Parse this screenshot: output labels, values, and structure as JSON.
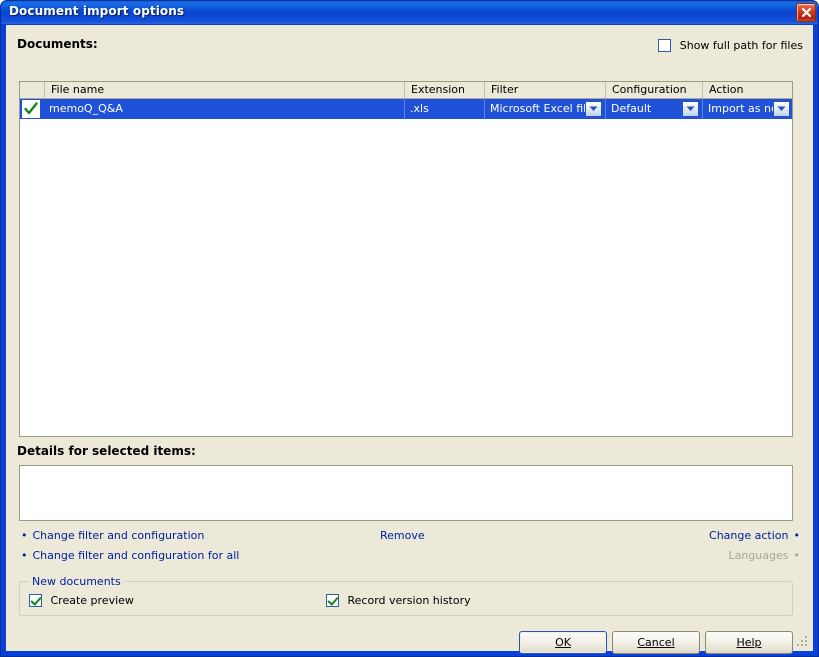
{
  "window": {
    "title": "Document import options",
    "close_icon": "close-icon"
  },
  "documents": {
    "label": "Documents:",
    "show_full_path": {
      "label": "Show full path for files",
      "checked": false
    },
    "columns": [
      "File name",
      "Extension",
      "Filter",
      "Configuration",
      "Action"
    ],
    "rows": [
      {
        "checked": true,
        "file_name": "memoQ_Q&A",
        "extension": ".xls",
        "filter": "Microsoft Excel filter",
        "configuration": "Default",
        "action": "Import as new"
      }
    ]
  },
  "details": {
    "label": "Details for selected items:",
    "text": ""
  },
  "links": {
    "change_filter": "Change filter and configuration",
    "change_filter_all": "Change filter and configuration for all",
    "remove": "Remove",
    "change_action": "Change action",
    "languages": "Languages"
  },
  "new_documents": {
    "caption": "New documents",
    "create_preview": {
      "label": "Create preview",
      "checked": true
    },
    "record_version_history": {
      "label": "Record version history",
      "checked": true
    }
  },
  "buttons": {
    "ok": "OK",
    "cancel": "Cancel",
    "help": "Help"
  },
  "colors": {
    "titlebar": "#0a4fd4",
    "selection": "#1f52d8",
    "dialog_face": "#ece9d8",
    "link": "#00209f",
    "link_disabled": "#a8a497",
    "check_green": "#108410"
  }
}
